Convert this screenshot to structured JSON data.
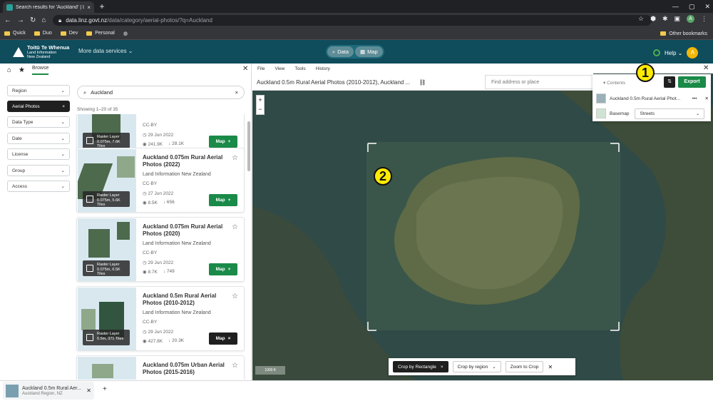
{
  "browser": {
    "tab_title": "Search results for 'Auckland' | LIN...",
    "tab_close": "×",
    "new_tab": "+",
    "url_host": "data.linz.govt.nz",
    "url_path": "/data/category/aerial-photos/?q=Auckland",
    "bookmarks": [
      "Quick",
      "Duo",
      "Dev",
      "Personal"
    ],
    "other_bookmarks": "Other bookmarks",
    "avatar": "A"
  },
  "header": {
    "logo_name": "Toitū Te Whenua",
    "logo_sub1": "Land Information",
    "logo_sub2": "New Zealand",
    "more_services": "More data services ⌄",
    "data_btn": "Data",
    "map_btn": "Map",
    "help": "Help ⌄",
    "user_initial": "A"
  },
  "sidebar": {
    "tab_browse": "Browse",
    "filters": [
      "Region",
      "Aerial Photos",
      "Data Type",
      "Date",
      "License",
      "Group",
      "Access"
    ],
    "search_value": "Auckland",
    "showing": "Showing 1–20 of 35"
  },
  "results": [
    {
      "title": "",
      "org": "",
      "license": "CC-BY",
      "badge1": "Raster Layer",
      "badge2": "0.075m, 7.6K",
      "badge3": "Tiles",
      "date": "29 Jun 2022",
      "views": "241.9K",
      "downloads": "28.1K",
      "map": "Map",
      "dark": false
    },
    {
      "title": "Auckland 0.075m Rural Aerial Photos (2022)",
      "org": "Land Information New Zealand",
      "license": "CC-BY",
      "badge1": "Raster Layer",
      "badge2": "0.075m, 5.6K",
      "badge3": "Tiles",
      "date": "27 Jun 2022",
      "views": "8.5K",
      "downloads": "656",
      "map": "Map",
      "dark": false
    },
    {
      "title": "Auckland 0.075m Rural Aerial Photos (2020)",
      "org": "Land Information New Zealand",
      "license": "CC-BY",
      "badge1": "Raster Layer",
      "badge2": "0.075m, 6.5K",
      "badge3": "Tiles",
      "date": "29 Jun 2022",
      "views": "8.7K",
      "downloads": "749",
      "map": "Map",
      "dark": false
    },
    {
      "title": "Auckland 0.5m Rural Aerial Photos (2010-2012)",
      "org": "Land Information New Zealand",
      "license": "CC-BY",
      "badge1": "Raster Layer",
      "badge2": "0.5m, 371 Tiles",
      "badge3": "",
      "date": "29 Jun 2022",
      "views": "427.8K",
      "downloads": "20.3K",
      "map": "Map",
      "dark": true
    },
    {
      "title": "Auckland 0.075m Urban Aerial Photos (2015-2016)",
      "org": "",
      "license": "",
      "badge1": "",
      "badge2": "",
      "badge3": "",
      "date": "",
      "views": "",
      "downloads": "",
      "map": "",
      "dark": false
    }
  ],
  "map": {
    "menu": [
      "File",
      "View",
      "Tools",
      "History"
    ],
    "layer_title": "Auckland 0.5m Rural Aerial Photos (2010-2012), Auckland ...",
    "place_placeholder": "Find address or place",
    "contents_label": "Contents",
    "export": "Export",
    "layer_row": "Auckland 0.5m Rural Aerial Phot...",
    "basemap_label": "Basemap",
    "basemap_value": "Streets",
    "callout1": "1",
    "callout2": "2",
    "crop_rect": "Crop by Rectangle",
    "crop_region": "Crop by region",
    "zoom_crop": "Zoom to Crop",
    "scale": "1000 ft"
  },
  "download": {
    "name": "Auckland 0.5m Rural Aer...",
    "sub": "Auckland Region, NZ"
  },
  "colors": {
    "brand": "#0f4c5c",
    "accent": "#1a8a48",
    "callout": "#ffeb00"
  }
}
